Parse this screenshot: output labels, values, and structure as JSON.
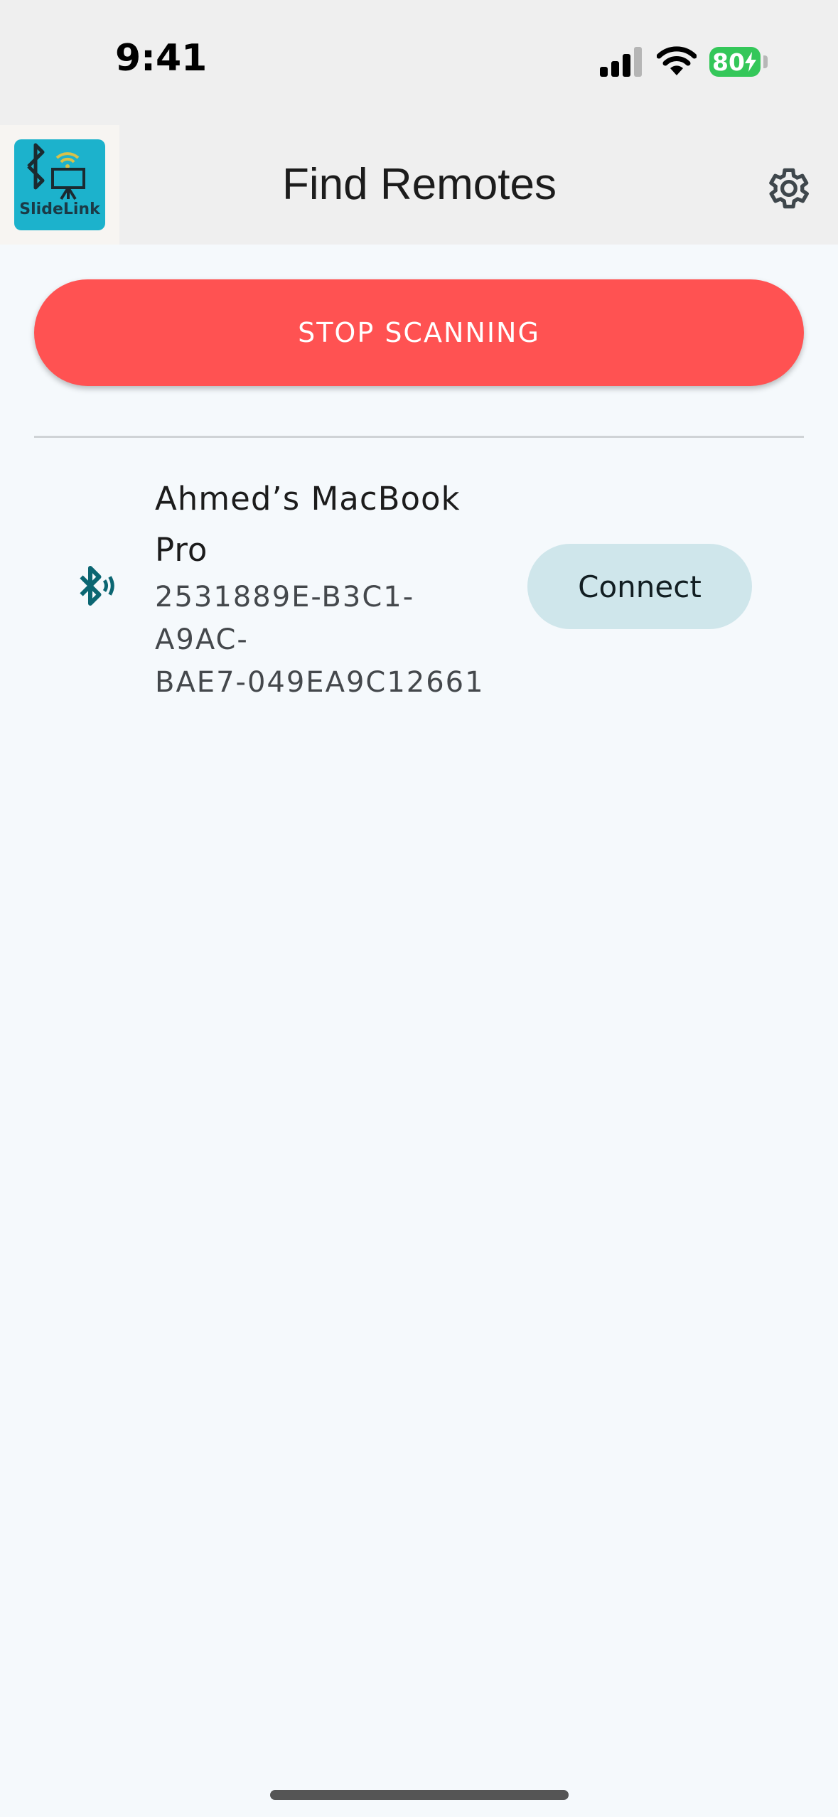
{
  "status_bar": {
    "time": "9:41",
    "battery": "80"
  },
  "app_bar": {
    "logo_text": "SlideLink",
    "title": "Find Remotes"
  },
  "scan_button": {
    "label": "STOP SCANNING"
  },
  "devices": [
    {
      "name": "Ahmed’s MacBook Pro",
      "id": "2531889E-B3C1-\nA9AC-\nBAE7-049EA9C12661",
      "action_label": "Connect"
    }
  ],
  "colors": {
    "accent_red": "#ff5252",
    "logo_teal": "#1cb2cc",
    "bluetooth_icon": "#0b6672",
    "connect_bg": "#cfe6eb",
    "battery_green": "#34c759"
  },
  "icons": {
    "signal": "cellular-signal-icon",
    "wifi": "wifi-icon",
    "battery": "battery-icon",
    "settings": "gear-icon",
    "bluetooth": "bluetooth-searching-icon"
  }
}
